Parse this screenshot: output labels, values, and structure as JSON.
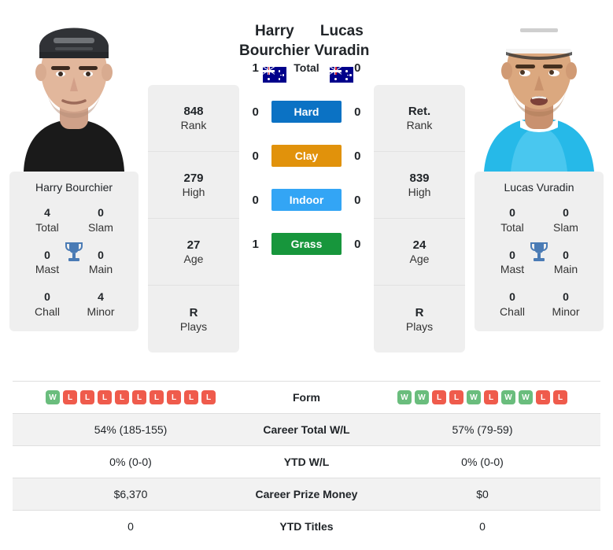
{
  "players": {
    "left": {
      "first_name": "Harry",
      "last_name": "Bourchier",
      "full_name": "Harry Bourchier",
      "country": "AUS",
      "photo_desc": "dark-cap-black-shirt",
      "titles": [
        {
          "value": "4",
          "label": "Total"
        },
        {
          "value": "0",
          "label": "Slam"
        },
        {
          "value": "0",
          "label": "Mast"
        },
        {
          "value": "0",
          "label": "Main"
        },
        {
          "value": "0",
          "label": "Chall"
        },
        {
          "value": "4",
          "label": "Minor"
        }
      ],
      "profile": [
        {
          "value": "848",
          "label": "Rank"
        },
        {
          "value": "279",
          "label": "High"
        },
        {
          "value": "27",
          "label": "Age"
        },
        {
          "value": "R",
          "label": "Plays"
        }
      ],
      "form": [
        "W",
        "L",
        "L",
        "L",
        "L",
        "L",
        "L",
        "L",
        "L",
        "L"
      ],
      "career_total_wl": "54% (185-155)",
      "ytd_wl": "0% (0-0)",
      "career_prize_money": "$6,370",
      "ytd_titles": "0"
    },
    "right": {
      "first_name": "Lucas",
      "last_name": "Vuradin",
      "full_name": "Lucas Vuradin",
      "country": "AUS",
      "photo_desc": "white-cap-cyan-shirt",
      "titles": [
        {
          "value": "0",
          "label": "Total"
        },
        {
          "value": "0",
          "label": "Slam"
        },
        {
          "value": "0",
          "label": "Mast"
        },
        {
          "value": "0",
          "label": "Main"
        },
        {
          "value": "0",
          "label": "Chall"
        },
        {
          "value": "0",
          "label": "Minor"
        }
      ],
      "profile": [
        {
          "value": "Ret.",
          "label": "Rank"
        },
        {
          "value": "839",
          "label": "High"
        },
        {
          "value": "24",
          "label": "Age"
        },
        {
          "value": "R",
          "label": "Plays"
        }
      ],
      "form": [
        "W",
        "W",
        "L",
        "L",
        "W",
        "L",
        "W",
        "W",
        "L",
        "L"
      ],
      "career_total_wl": "57% (79-59)",
      "ytd_wl": "0% (0-0)",
      "career_prize_money": "$0",
      "ytd_titles": "0"
    }
  },
  "head_to_head": [
    {
      "label": "Total",
      "left": "1",
      "right": "0",
      "color": "",
      "text_color": "#212529"
    },
    {
      "label": "Hard",
      "left": "0",
      "right": "0",
      "color": "#0b72c4",
      "text_color": "#ffffff"
    },
    {
      "label": "Clay",
      "left": "0",
      "right": "0",
      "color": "#e1920b",
      "text_color": "#ffffff"
    },
    {
      "label": "Indoor",
      "left": "0",
      "right": "0",
      "color": "#33a5f5",
      "text_color": "#ffffff"
    },
    {
      "label": "Grass",
      "left": "1",
      "right": "0",
      "color": "#17963c",
      "text_color": "#ffffff"
    }
  ],
  "comparison_rows": [
    {
      "label": "Form",
      "left": "",
      "right": "",
      "type": "form"
    },
    {
      "label": "Career Total W/L",
      "left": "54% (185-155)",
      "right": "57% (79-59)",
      "type": "text"
    },
    {
      "label": "YTD W/L",
      "left": "0% (0-0)",
      "right": "0% (0-0)",
      "type": "text"
    },
    {
      "label": "Career Prize Money",
      "left": "$6,370",
      "right": "$0",
      "type": "text"
    },
    {
      "label": "YTD Titles",
      "left": "0",
      "right": "0",
      "type": "text"
    }
  ],
  "colors": {
    "win": "#6abd7d",
    "loss": "#ef5b4c",
    "trophy": "#4a7bb5",
    "card_bg": "#efefef",
    "row_alt_bg": "#f2f2f2"
  }
}
